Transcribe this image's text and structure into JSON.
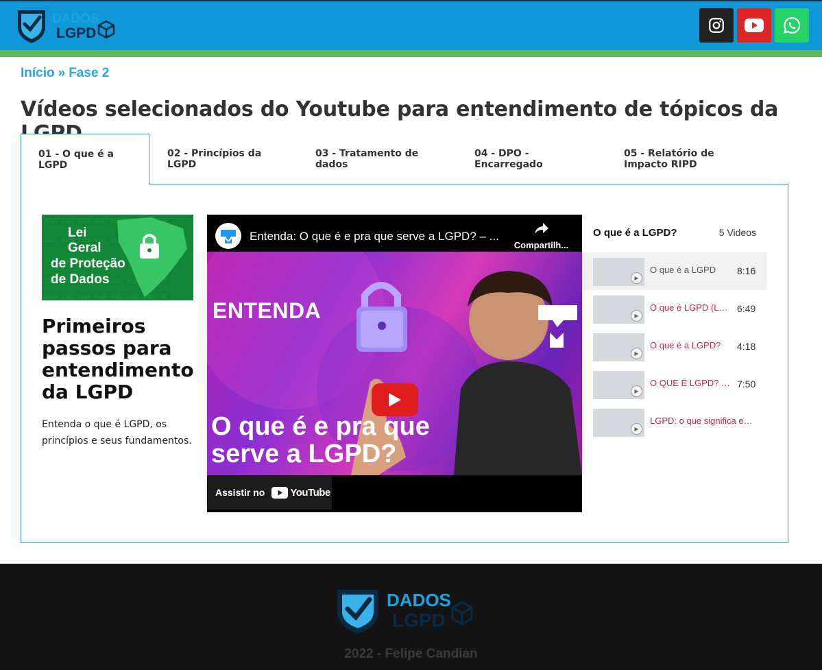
{
  "brand": {
    "logo_text_top": "DADOS",
    "logo_text_bottom": "LGPD"
  },
  "social": [
    {
      "name": "instagram",
      "icon": "instagram-icon",
      "color": "#222222"
    },
    {
      "name": "youtube",
      "icon": "youtube-icon",
      "color": "#dd2727"
    },
    {
      "name": "whatsapp",
      "icon": "whatsapp-icon",
      "color": "#25d366"
    }
  ],
  "breadcrumb": {
    "home": "Início",
    "separator": "»",
    "current": "Fase 2"
  },
  "page_title": "Vídeos selecionados do Youtube para entendimento de tópicos da LGPD",
  "tabs": [
    {
      "label": "01 - O que é a LGPD"
    },
    {
      "label": "02 - Princípios da LGPD"
    },
    {
      "label": "03 - Tratamento de dados"
    },
    {
      "label": "04 - DPO - Encarregado"
    },
    {
      "label": "05 - Relatório de Impacto RIPD"
    }
  ],
  "intro": {
    "cover_lines": [
      "Lei",
      "Geral",
      "de Proteção",
      "de Dados"
    ],
    "title": "Primeiros passos para entendimento da LGPD",
    "text": "Entenda o que é LGPD, os princípios e seus fundamentos."
  },
  "video": {
    "title": "Entenda: O que é e pra que serve a LGPD? – ...",
    "share_label": "Compartilh...",
    "overlay_top": "ENTENDA",
    "overlay_big": "O que é e pra que serve a LGPD?",
    "watch_on": "Assistir no",
    "youtube_word": "YouTube"
  },
  "playlist": {
    "title": "O que é a LGPD?",
    "count": "5 Videos",
    "items": [
      {
        "title": "O que é a LGPD",
        "duration": "8:16"
      },
      {
        "title": "O que é LGPD (Lei Geral de Proteção de Dados)",
        "duration": "6:49"
      },
      {
        "title": "O que é a LGPD?",
        "duration": "4:18"
      },
      {
        "title": "O QUE É LGPD? (Lei Geral)",
        "duration": "7:50"
      },
      {
        "title": "LGPD: o que significa e como funciona",
        "duration": ""
      }
    ]
  },
  "footer": {
    "copyright": "2022 - Felipe Candian"
  }
}
